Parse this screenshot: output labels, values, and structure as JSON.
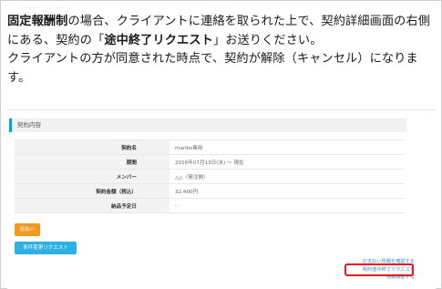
{
  "intro": {
    "part1_bold": "固定報酬制",
    "part2": "の場合、クライアントに連絡を取られた上で、契約詳細画面の右側にある、契約の「",
    "part3_bold": "途中終了リクエスト",
    "part4": "」お送りください。",
    "line2": "クライアントの方が同意された時点で、契約が解除（キャンセル）になります。"
  },
  "card": {
    "title": "契約内容",
    "rows": [
      {
        "label": "契約名",
        "value": "mariko専用"
      },
      {
        "label": "期間",
        "value": "2016年07月13日(水) ～ 現在"
      },
      {
        "label": "メンバー",
        "value": "△△（発注側）"
      },
      {
        "label": "契約金額（税込）",
        "value": "32,400円"
      },
      {
        "label": "納品予定日",
        "value": "-"
      }
    ]
  },
  "buttons": {
    "pay": "仮払い",
    "change": "条件変更リクエスト"
  },
  "links": {
    "first": "お支払い情報を確認する",
    "end_request": "契約途中終了リクエスト",
    "last": "通報機能する"
  },
  "colors": {
    "accent": "#0aa0c8",
    "pay_button": "#f39a1e",
    "change_button": "#2db0e6",
    "highlight": "#e8141e",
    "link": "#3a8fd0"
  }
}
